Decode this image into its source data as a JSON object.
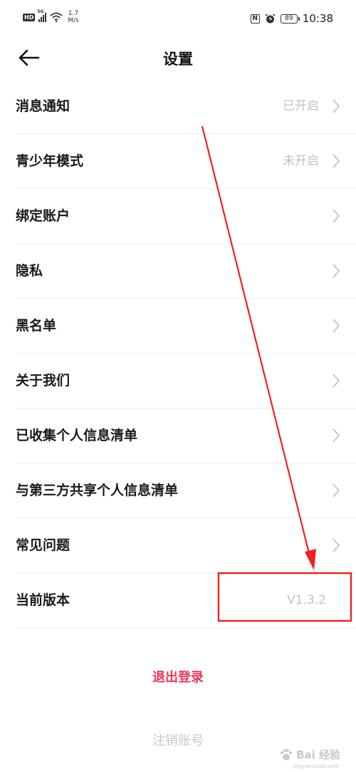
{
  "status_bar": {
    "hd": "HD",
    "signal": "5G",
    "speed_value": "1.7",
    "speed_unit": "M/s",
    "nfc": "N",
    "battery": "89",
    "time": "10:38"
  },
  "header": {
    "title": "设置",
    "back_icon": "arrow-left-icon"
  },
  "settings": [
    {
      "label": "消息通知",
      "value": "已开启",
      "arrow": true
    },
    {
      "label": "青少年模式",
      "value": "未开启",
      "arrow": true
    },
    {
      "label": "绑定账户",
      "value": "",
      "arrow": true
    },
    {
      "label": "隐私",
      "value": "",
      "arrow": true
    },
    {
      "label": "黑名单",
      "value": "",
      "arrow": true
    },
    {
      "label": "关于我们",
      "value": "",
      "arrow": true
    },
    {
      "label": "已收集个人信息清单",
      "value": "",
      "arrow": true
    },
    {
      "label": "与第三方共享个人信息清单",
      "value": "",
      "arrow": true
    },
    {
      "label": "常见问题",
      "value": "",
      "arrow": true
    },
    {
      "label": "当前版本",
      "value": "V1.3.2",
      "arrow": false
    }
  ],
  "actions": {
    "logout": "退出登录",
    "cancel_account": "注销账号"
  },
  "annotation": {
    "color": "#f0201c"
  },
  "watermark": {
    "text": "Bai 经验",
    "sub": "jingyan.baidu.com"
  },
  "colors": {
    "accent": "#f0385c",
    "muted": "#c3c3c3",
    "divider": "#efefef"
  }
}
